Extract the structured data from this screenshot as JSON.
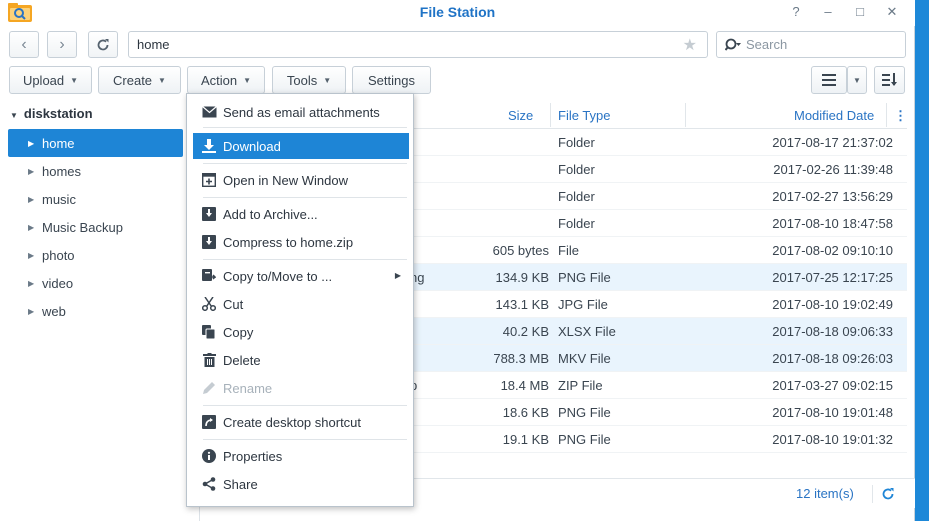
{
  "window": {
    "title": "File Station"
  },
  "controls": {
    "help": "?",
    "minimize": "–",
    "maximize": "□",
    "close": "✕"
  },
  "nav": {
    "path": "home",
    "search_placeholder": "Search"
  },
  "toolbar": {
    "upload": "Upload",
    "create": "Create",
    "action": "Action",
    "tools": "Tools",
    "settings": "Settings"
  },
  "sidebar": {
    "root": "diskstation",
    "items": [
      {
        "label": "home",
        "selected": true
      },
      {
        "label": "homes"
      },
      {
        "label": "music"
      },
      {
        "label": "Music Backup"
      },
      {
        "label": "photo"
      },
      {
        "label": "video"
      },
      {
        "label": "web"
      }
    ]
  },
  "columns": {
    "size": "Size",
    "type": "File Type",
    "modified": "Modified Date"
  },
  "files": [
    {
      "name_tail": "",
      "size": "",
      "type": "Folder",
      "modified": "2017-08-17 21:37:02"
    },
    {
      "name_tail": "",
      "size": "",
      "type": "Folder",
      "modified": "2017-02-26 11:39:48"
    },
    {
      "name_tail": "",
      "size": "",
      "type": "Folder",
      "modified": "2017-02-27 13:56:29"
    },
    {
      "name_tail": "",
      "size": "",
      "type": "Folder",
      "modified": "2017-08-10 18:47:58"
    },
    {
      "name_tail": "",
      "size": "605 bytes",
      "type": "File",
      "modified": "2017-08-02 09:10:10"
    },
    {
      "name_tail": "ng",
      "size": "134.9 KB",
      "type": "PNG File",
      "modified": "2017-07-25 12:17:25"
    },
    {
      "name_tail": "",
      "size": "143.1 KB",
      "type": "JPG File",
      "modified": "2017-08-10 19:02:49"
    },
    {
      "name_tail": "",
      "size": "40.2 KB",
      "type": "XLSX File",
      "modified": "2017-08-18 09:06:33"
    },
    {
      "name_tail": "",
      "size": "788.3 MB",
      "type": "MKV File",
      "modified": "2017-08-18 09:26:03"
    },
    {
      "name_tail": "p",
      "size": "18.4 MB",
      "type": "ZIP File",
      "modified": "2017-03-27 09:02:15"
    },
    {
      "name_tail": "",
      "size": "18.6 KB",
      "type": "PNG File",
      "modified": "2017-08-10 19:01:48"
    },
    {
      "name_tail": "",
      "size": "19.1 KB",
      "type": "PNG File",
      "modified": "2017-08-10 19:01:32"
    }
  ],
  "footer": {
    "count": "12 item(s)"
  },
  "context_menu": {
    "email": "Send as email attachments",
    "download": "Download",
    "open_new": "Open in New Window",
    "add_archive": "Add to Archive...",
    "compress": "Compress to home.zip",
    "copy_move": "Copy to/Move to ...",
    "cut": "Cut",
    "copy": "Copy",
    "delete": "Delete",
    "rename": "Rename",
    "shortcut": "Create desktop shortcut",
    "properties": "Properties",
    "share": "Share"
  },
  "colors": {
    "accent": "#1e85d6",
    "title": "#1f73c6",
    "desktop": "#1d88d8",
    "row_highlight": "#e9f4fd"
  }
}
